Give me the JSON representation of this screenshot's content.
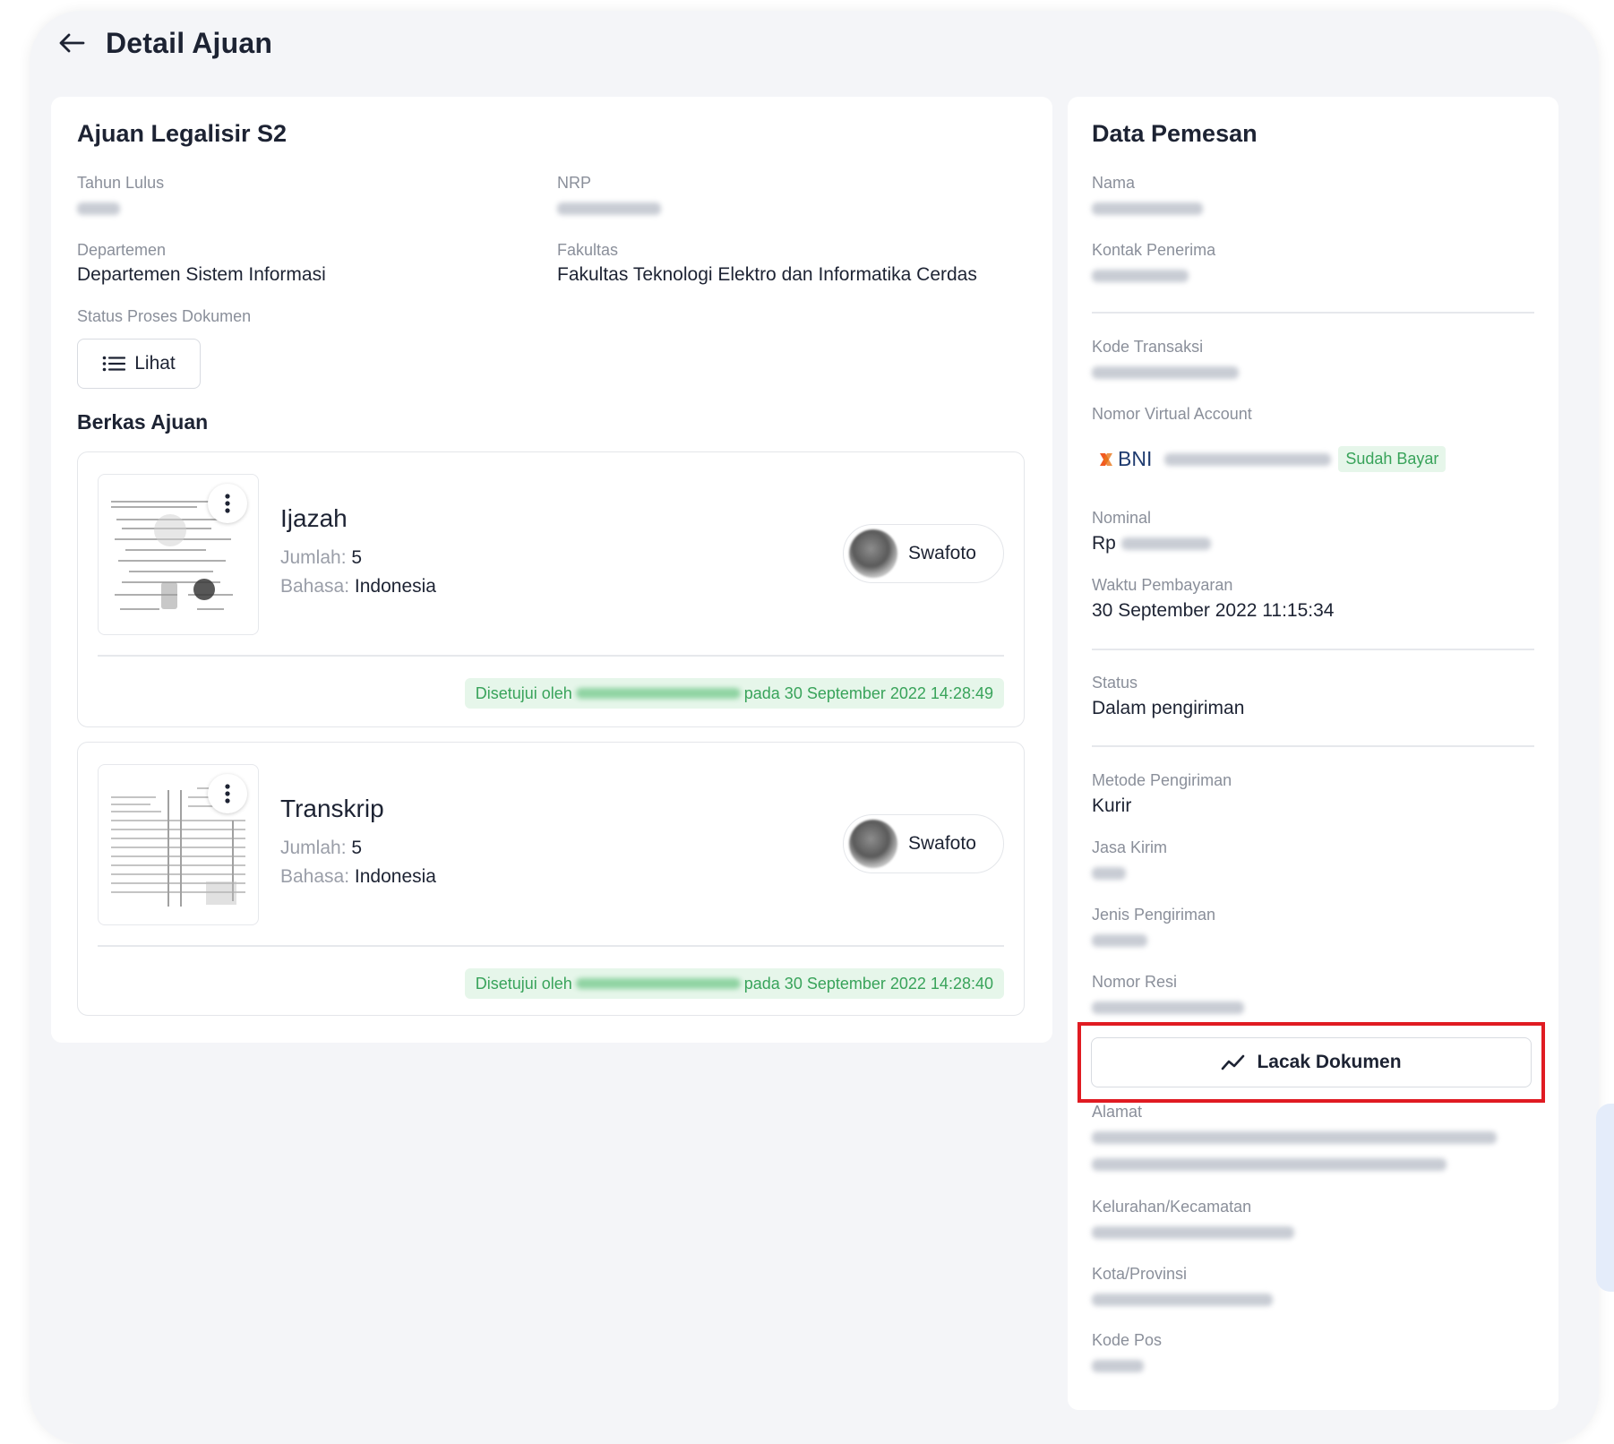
{
  "header": {
    "title": "Detail Ajuan"
  },
  "submission": {
    "title": "Ajuan Legalisir S2",
    "tahun_lulus_label": "Tahun Lulus",
    "nrp_label": "NRP",
    "departemen_label": "Departemen",
    "departemen_value": "Departemen Sistem Informasi",
    "fakultas_label": "Fakultas",
    "fakultas_value": "Fakultas Teknologi Elektro dan Informatika Cerdas",
    "status_label": "Status Proses Dokumen",
    "lihat_label": "Lihat",
    "berkas_title": "Berkas Ajuan"
  },
  "documents": [
    {
      "name": "Ijazah",
      "jumlah_label": "Jumlah:",
      "jumlah_value": "5",
      "bahasa_label": "Bahasa:",
      "bahasa_value": "Indonesia",
      "swafoto_label": "Swafoto",
      "approved_prefix": "Disetujui oleh",
      "approved_suffix": "pada 30 September 2022 14:28:49"
    },
    {
      "name": "Transkrip",
      "jumlah_label": "Jumlah:",
      "jumlah_value": "5",
      "bahasa_label": "Bahasa:",
      "bahasa_value": "Indonesia",
      "swafoto_label": "Swafoto",
      "approved_prefix": "Disetujui oleh",
      "approved_suffix": "pada 30 September 2022 14:28:40"
    }
  ],
  "orderer": {
    "title": "Data Pemesan",
    "nama_label": "Nama",
    "kontak_label": "Kontak Penerima",
    "kode_transaksi_label": "Kode Transaksi",
    "va_label": "Nomor Virtual Account",
    "bank_name": "BNI",
    "paid_badge": "Sudah Bayar",
    "nominal_label": "Nominal",
    "nominal_prefix": "Rp",
    "waktu_label": "Waktu Pembayaran",
    "waktu_value": "30 September 2022 11:15:34",
    "status_label": "Status",
    "status_value": "Dalam pengiriman",
    "metode_label": "Metode Pengiriman",
    "metode_value": "Kurir",
    "jasa_label": "Jasa Kirim",
    "jenis_label": "Jenis Pengiriman",
    "resi_label": "Nomor Resi",
    "lacak_label": "Lacak Dokumen",
    "alamat_label": "Alamat",
    "kelurahan_label": "Kelurahan/Kecamatan",
    "kota_label": "Kota/Provinsi",
    "kodepos_label": "Kode Pos"
  },
  "colors": {
    "accent_red": "#e01b22",
    "success_green": "#38a35a",
    "bni_orange": "#f15a22"
  }
}
